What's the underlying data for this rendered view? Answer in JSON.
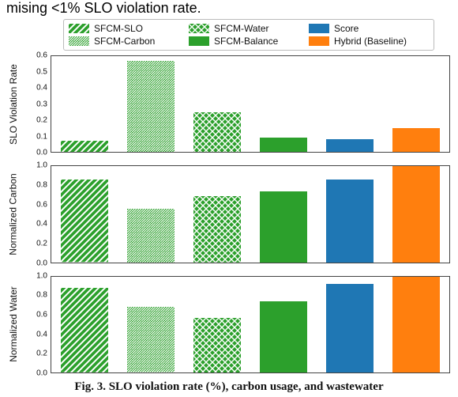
{
  "cropped_text": "mising <1% SLO violation rate.",
  "legend": {
    "items": [
      {
        "key": "sfcm_slo",
        "label": "SFCM-SLO",
        "fill": "#2ca02c",
        "pattern": "diag"
      },
      {
        "key": "sfcm_carbon",
        "label": "SFCM-Carbon",
        "fill": "#2ca02c",
        "pattern": "hatch"
      },
      {
        "key": "sfcm_water",
        "label": "SFCM-Water",
        "fill": "#2ca02c",
        "pattern": "cross"
      },
      {
        "key": "sfcm_balance",
        "label": "SFCM-Balance",
        "fill": "#2ca02c",
        "pattern": "solid"
      },
      {
        "key": "score",
        "label": "Score",
        "fill": "#1f77b4",
        "pattern": "solid"
      },
      {
        "key": "hybrid",
        "label": "Hybrid (Baseline)",
        "fill": "#ff7f0e",
        "pattern": "solid"
      }
    ]
  },
  "caption": "Fig. 3. SLO violation rate (%), carbon usage, and wastewater",
  "chart_data": [
    {
      "type": "bar",
      "ylabel": "SLO Violation Rate",
      "ylim": [
        0,
        0.6
      ],
      "yticks": [
        0.0,
        0.1,
        0.2,
        0.3,
        0.4,
        0.5,
        0.6
      ],
      "ytick_labels": [
        "0.0",
        "0.1",
        "0.2",
        "0.3",
        "0.4",
        "0.5",
        "0.6"
      ],
      "categories": [
        "SFCM-SLO",
        "SFCM-Carbon",
        "SFCM-Water",
        "SFCM-Balance",
        "Score",
        "Hybrid (Baseline)"
      ],
      "values": [
        0.07,
        0.57,
        0.25,
        0.09,
        0.08,
        0.15
      ]
    },
    {
      "type": "bar",
      "ylabel": "Normalized Carbon",
      "ylim": [
        0,
        1.0
      ],
      "yticks": [
        0.0,
        0.2,
        0.4,
        0.6,
        0.8,
        1.0
      ],
      "ytick_labels": [
        "0.0",
        "0.2",
        "0.4",
        "0.6",
        "0.8",
        "1.0"
      ],
      "categories": [
        "SFCM-SLO",
        "SFCM-Carbon",
        "SFCM-Water",
        "SFCM-Balance",
        "Score",
        "Hybrid (Baseline)"
      ],
      "values": [
        0.86,
        0.56,
        0.69,
        0.74,
        0.86,
        1.0
      ]
    },
    {
      "type": "bar",
      "ylabel": "Normalized Water",
      "ylim": [
        0,
        1.0
      ],
      "yticks": [
        0.0,
        0.2,
        0.4,
        0.6,
        0.8,
        1.0
      ],
      "ytick_labels": [
        "0.0",
        "0.2",
        "0.4",
        "0.6",
        "0.8",
        "1.0"
      ],
      "categories": [
        "SFCM-SLO",
        "SFCM-Carbon",
        "SFCM-Water",
        "SFCM-Balance",
        "Score",
        "Hybrid (Baseline)"
      ],
      "values": [
        0.88,
        0.68,
        0.57,
        0.74,
        0.92,
        1.0
      ]
    }
  ]
}
